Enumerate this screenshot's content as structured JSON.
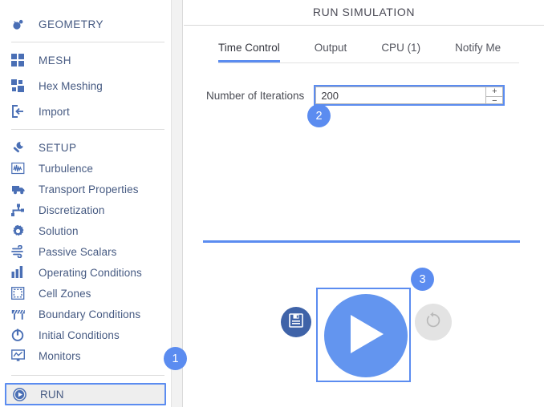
{
  "sidebar": {
    "groups": [
      {
        "items": [
          {
            "label": "GEOMETRY",
            "icon": "geometry-icon",
            "section": true
          }
        ]
      },
      {
        "items": [
          {
            "label": "MESH",
            "icon": "mesh-grid-icon",
            "section": true
          },
          {
            "label": "Hex Meshing",
            "icon": "hex-mesh-icon",
            "section": false
          },
          {
            "label": "Import",
            "icon": "import-icon",
            "section": false
          }
        ]
      },
      {
        "items": [
          {
            "label": "SETUP",
            "icon": "wrench-icon",
            "section": true
          },
          {
            "label": "Turbulence",
            "icon": "turbulence-waveform-icon",
            "section": false
          },
          {
            "label": "Transport Properties",
            "icon": "truck-icon",
            "section": false
          },
          {
            "label": "Discretization",
            "icon": "discretization-step-icon",
            "section": false
          },
          {
            "label": "Solution",
            "icon": "gear-icon",
            "section": false
          },
          {
            "label": "Passive Scalars",
            "icon": "wind-icon",
            "section": false
          },
          {
            "label": "Operating Conditions",
            "icon": "bar-chart-icon",
            "section": false
          },
          {
            "label": "Cell Zones",
            "icon": "dashed-square-icon",
            "section": false
          },
          {
            "label": "Boundary Conditions",
            "icon": "barrier-icon",
            "section": false
          },
          {
            "label": "Initial Conditions",
            "icon": "power-icon",
            "section": false
          },
          {
            "label": "Monitors",
            "icon": "monitor-chart-icon",
            "section": false
          }
        ]
      },
      {
        "items": [
          {
            "label": "RUN",
            "icon": "play-circle-icon",
            "section": false,
            "selected": true
          }
        ]
      }
    ]
  },
  "main": {
    "title": "RUN SIMULATION",
    "tabs": [
      {
        "label": "Time Control",
        "active": true
      },
      {
        "label": "Output",
        "active": false
      },
      {
        "label": "CPU  (1)",
        "active": false
      },
      {
        "label": "Notify Me",
        "active": false
      }
    ],
    "field": {
      "label": "Number of Iterations",
      "value": "200",
      "placeholder": "",
      "spinner_up": "+",
      "spinner_down": "−"
    },
    "actions": {
      "save_icon": "floppy-disk-save-icon",
      "play_icon": "play-triangle-icon",
      "reset_icon": "reset-refresh-icon"
    }
  },
  "badges": [
    {
      "number": "1"
    },
    {
      "number": "2"
    },
    {
      "number": "3"
    }
  ],
  "colors": {
    "accent": "#5b8cf0",
    "play": "#6395ef",
    "save": "#3f63a8",
    "reset": "#e3e3e3",
    "nav_text": "#465a82",
    "selected_bg": "#eeeeee"
  }
}
